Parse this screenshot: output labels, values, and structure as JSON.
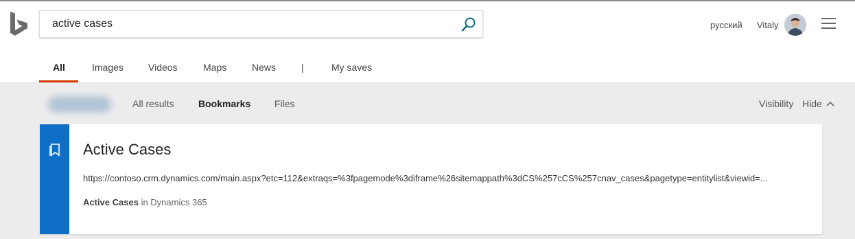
{
  "search": {
    "query": "active cases"
  },
  "header": {
    "language": "русский",
    "user_name": "Vitaly"
  },
  "nav_tabs": [
    "All",
    "Images",
    "Videos",
    "Maps",
    "News",
    "|",
    "My saves"
  ],
  "active_tab": "All",
  "sub_tabs": [
    "All results",
    "Bookmarks",
    "Files"
  ],
  "active_sub_tab": "Bookmarks",
  "controls": {
    "visibility": "Visibility",
    "hide": "Hide"
  },
  "result": {
    "title": "Active Cases",
    "url": "https://contoso.crm.dynamics.com/main.aspx?etc=112&extraqs=%3fpagemode%3diframe%26sitemappath%3dCS%257cCS%257cnav_cases&pagetype=entitylist&viewid=...",
    "source_name": "Active Cases",
    "source_suffix": " in Dynamics 365"
  },
  "colors": {
    "accent_blue": "#0f6fc6",
    "tab_underline": "#d83b01",
    "search_icon": "#0c6a84"
  }
}
